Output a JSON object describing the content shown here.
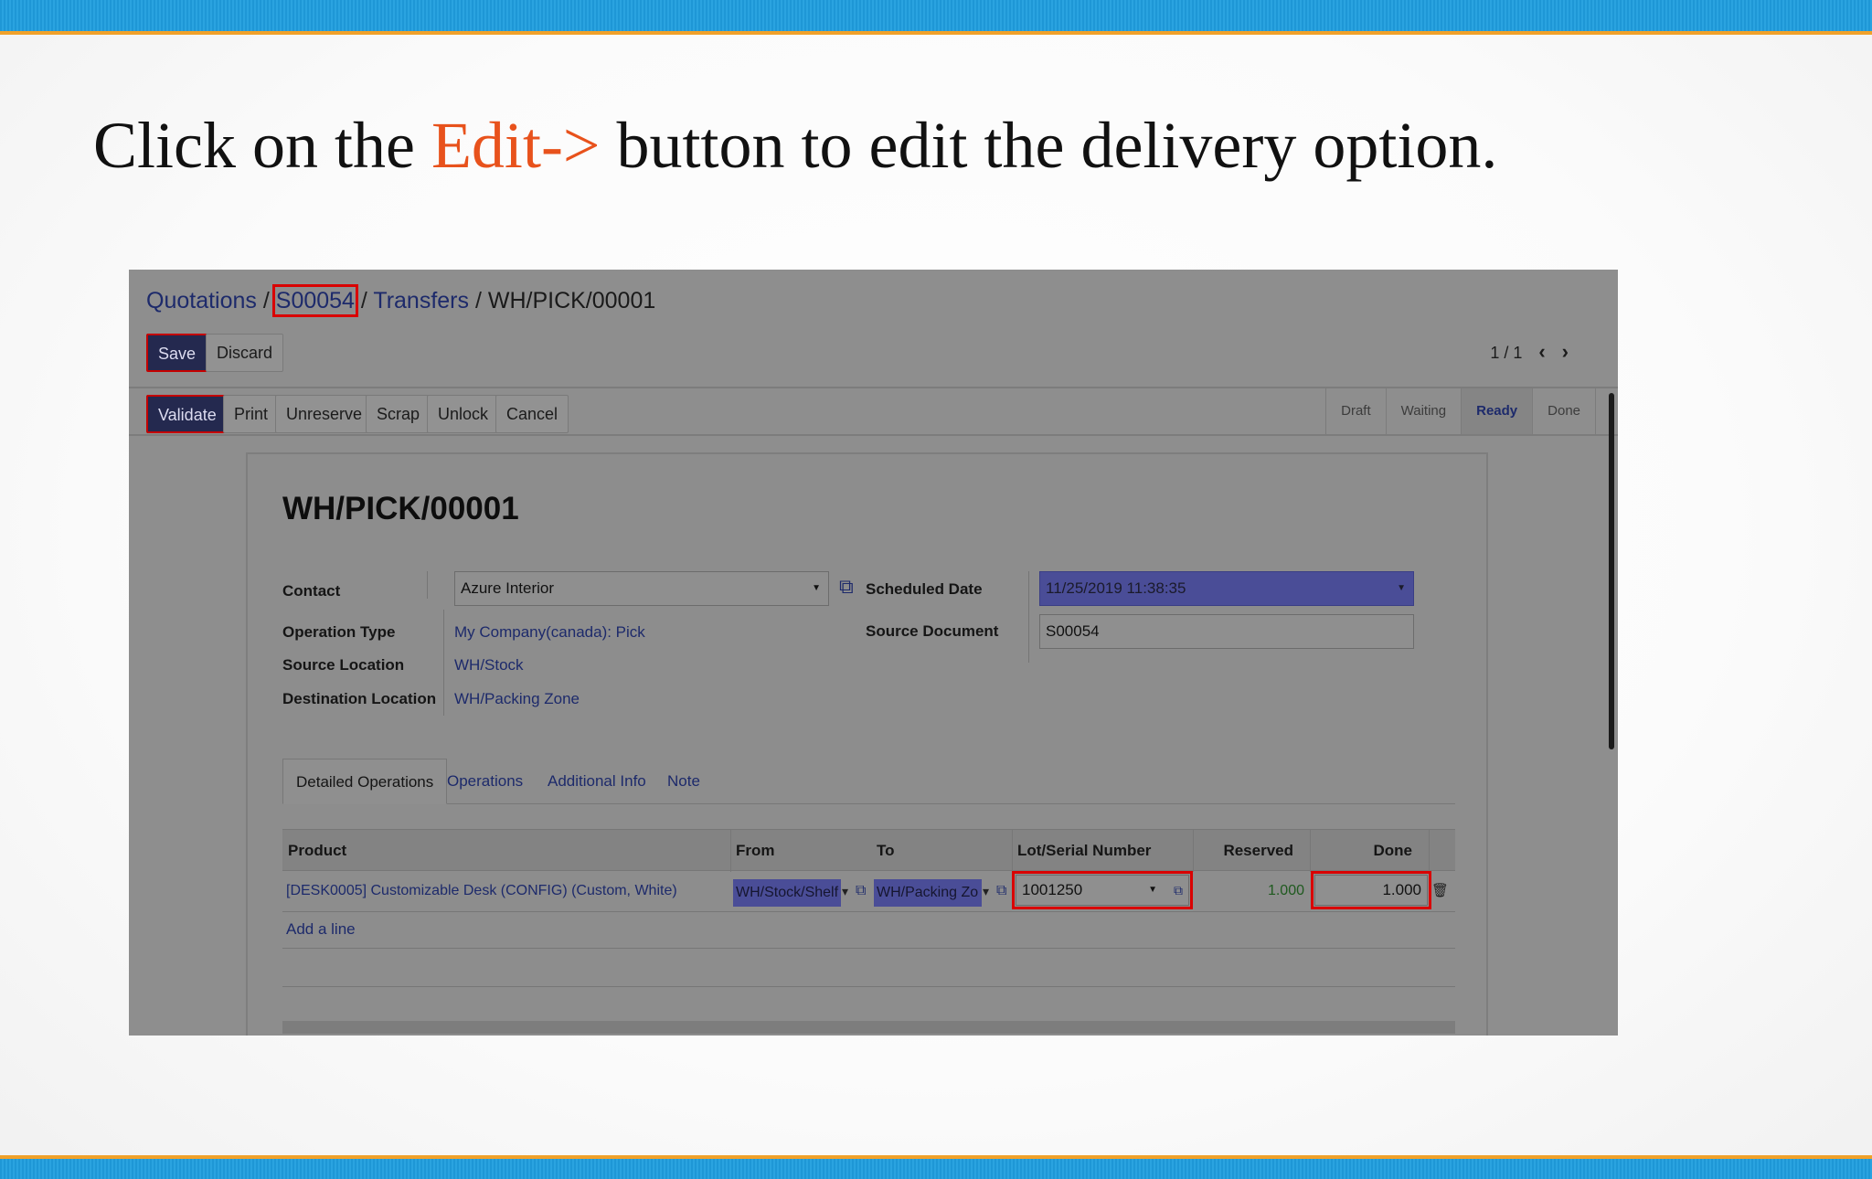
{
  "slide": {
    "title_before": "Click on the ",
    "title_accent": "Edit->",
    "title_after": " button to edit the delivery option."
  },
  "breadcrumb": {
    "quotations": "Quotations",
    "sep1": " / ",
    "order": "S00054",
    "sep2": " / ",
    "transfers": "Transfers",
    "sep3": " / ",
    "current": "WH/PICK/00001"
  },
  "toolbar": {
    "save": "Save",
    "discard": "Discard"
  },
  "pager": {
    "text": "1 / 1",
    "prev": "‹",
    "next": "›"
  },
  "actions": {
    "validate": "Validate",
    "print": "Print",
    "unreserve": "Unreserve",
    "scrap": "Scrap",
    "unlock": "Unlock",
    "cancel": "Cancel"
  },
  "statusbar": {
    "draft": "Draft",
    "waiting": "Waiting",
    "ready": "Ready",
    "done": "Done",
    "active": "Ready"
  },
  "record": {
    "title": "WH/PICK/00001",
    "contact_label": "Contact",
    "contact_value": "Azure Interior",
    "operation_type_label": "Operation Type",
    "operation_type_value": "My Company(canada): Pick",
    "source_location_label": "Source Location",
    "source_location_value": "WH/Stock",
    "destination_location_label": "Destination Location",
    "destination_location_value": "WH/Packing Zone",
    "scheduled_date_label": "Scheduled Date",
    "scheduled_date_value": "11/25/2019 11:38:35",
    "source_document_label": "Source Document",
    "source_document_value": "S00054"
  },
  "tabs": [
    "Detailed Operations",
    "Operations",
    "Additional Info",
    "Note"
  ],
  "table": {
    "headers": [
      "Product",
      "From",
      "To",
      "Lot/Serial Number",
      "Reserved",
      "Done"
    ],
    "rows": [
      {
        "product": "[DESK0005] Customizable Desk (CONFIG) (Custom, White)",
        "from": "WH/Stock/Shelf",
        "to": "WH/Packing Zo",
        "lot": "1001250",
        "reserved": "1.000",
        "done": "1.000"
      }
    ],
    "add_line": "Add a line"
  },
  "colors": {
    "accent": "#e8521c",
    "band": "#1e97d6",
    "band_edge": "#f0a12a",
    "highlight": "#d90000",
    "primary_btn": "#24294f"
  },
  "icons": [
    "external-link-icon",
    "dropdown-caret-icon",
    "trash-icon",
    "chevron-left-icon",
    "chevron-right-icon"
  ]
}
